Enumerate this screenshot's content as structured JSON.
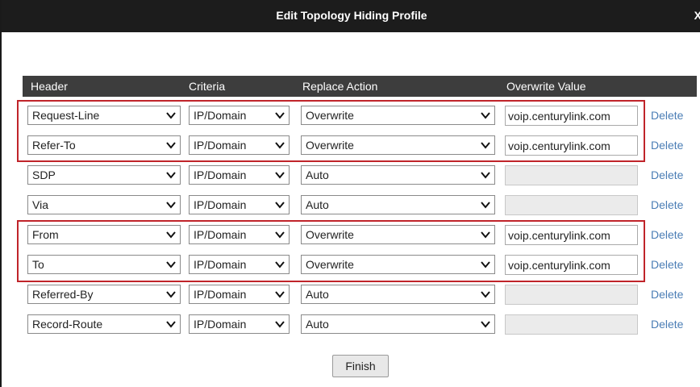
{
  "dialog": {
    "title": "Edit Topology Hiding Profile",
    "close_label": "X"
  },
  "columns": {
    "header": "Header",
    "criteria": "Criteria",
    "replace_action": "Replace Action",
    "overwrite_value": "Overwrite Value"
  },
  "rows": [
    {
      "header": "Request-Line",
      "criteria": "IP/Domain",
      "action": "Overwrite",
      "value": "voip.centurylink.com",
      "delete": "Delete"
    },
    {
      "header": "Refer-To",
      "criteria": "IP/Domain",
      "action": "Overwrite",
      "value": "voip.centurylink.com",
      "delete": "Delete"
    },
    {
      "header": "SDP",
      "criteria": "IP/Domain",
      "action": "Auto",
      "value": "",
      "delete": "Delete"
    },
    {
      "header": "Via",
      "criteria": "IP/Domain",
      "action": "Auto",
      "value": "",
      "delete": "Delete"
    },
    {
      "header": "From",
      "criteria": "IP/Domain",
      "action": "Overwrite",
      "value": "voip.centurylink.com",
      "delete": "Delete"
    },
    {
      "header": "To",
      "criteria": "IP/Domain",
      "action": "Overwrite",
      "value": "voip.centurylink.com",
      "delete": "Delete"
    },
    {
      "header": "Referred-By",
      "criteria": "IP/Domain",
      "action": "Auto",
      "value": "",
      "delete": "Delete"
    },
    {
      "header": "Record-Route",
      "criteria": "IP/Domain",
      "action": "Auto",
      "value": "",
      "delete": "Delete"
    }
  ],
  "footer": {
    "finish_label": "Finish"
  },
  "colors": {
    "title_bar": "#1c1c1c",
    "table_header": "#3d3d3d",
    "highlight": "#c0242a",
    "link": "#4a7db5"
  }
}
